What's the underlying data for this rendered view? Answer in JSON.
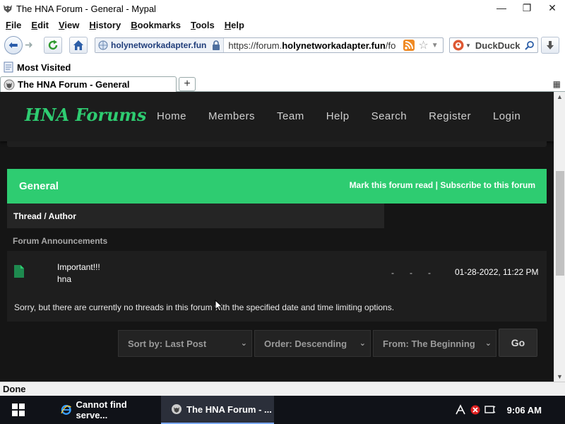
{
  "window": {
    "title": "The HNA Forum - General - Mypal",
    "icon": "mypal-wolf-icon",
    "controls": {
      "minimize": "—",
      "restore": "❐",
      "close": "✕"
    }
  },
  "menu": [
    "File",
    "Edit",
    "View",
    "History",
    "Bookmarks",
    "Tools",
    "Help"
  ],
  "toolbar": {
    "identity_label": "holynetworkadapter.fun",
    "url_prefix": "https://forum.",
    "url_host": "holynetworkadapter.fun",
    "url_suffix": "/fo",
    "search_placeholder": "DuckDuck"
  },
  "bookmarks": {
    "most_visited": "Most Visited"
  },
  "tabs": [
    {
      "label": "The HNA Forum - General"
    }
  ],
  "site": {
    "logo": "HNA Forums",
    "accent_color": "#2ecc71",
    "nav": [
      "Home",
      "Members",
      "Team",
      "Help",
      "Search",
      "Register",
      "Login"
    ]
  },
  "forum": {
    "name": "General",
    "mark_read": "Mark this forum read",
    "separator": "|",
    "subscribe": "Subscribe to this forum",
    "column_header": "Thread / Author",
    "announcements_label": "Forum Announcements",
    "announcement": {
      "title": "Important!!!",
      "author": "hna",
      "col1": "-",
      "col2": "-",
      "col3": "-",
      "last_post": "01-28-2022, 11:22 PM"
    },
    "empty_message": "Sorry, but there are currently no threads in this forum with the specified date and time limiting options.",
    "filters": {
      "sort_by": "Sort by: Last Post",
      "order": "Order: Descending",
      "from": "From: The Beginning",
      "go": "Go"
    }
  },
  "status": {
    "text": "Done"
  },
  "taskbar": {
    "items": [
      {
        "label": "Cannot find serve...",
        "icon": "ie-icon"
      },
      {
        "label": "The HNA Forum - ...",
        "icon": "mypal-wolf-icon"
      }
    ],
    "time": "9:06 AM"
  }
}
